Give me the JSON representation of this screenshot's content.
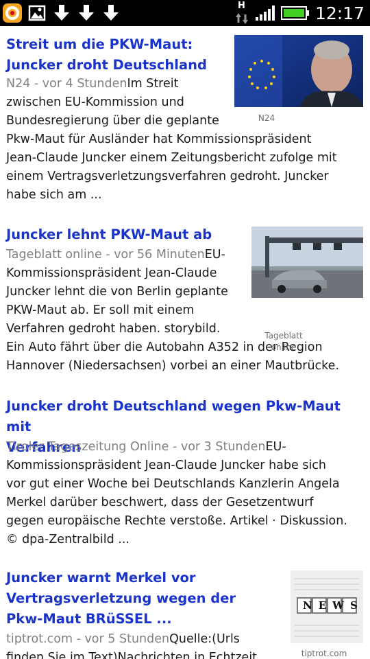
{
  "status_bar": {
    "time": "12:17",
    "network_type": "H",
    "icons": [
      "notification-app-icon",
      "image-icon",
      "download-icon",
      "download-icon",
      "download-icon",
      "data-arrows-icon",
      "signal-icon",
      "battery-icon"
    ]
  },
  "articles": [
    {
      "headline_lines": [
        "Streit um die PKW-Maut:",
        "Juncker droht Deutschland"
      ],
      "source": "N24 - vor 4 Stunden",
      "body_lines": [
        "Im Streit",
        "zwischen EU-Kommission und",
        "Bundesregierung über die geplante",
        "Pkw-Maut für Ausländer hat Kommissionspräsident",
        "Jean-Claude Juncker einem Zeitungsbericht zufolge mit",
        "einem Vertragsverletzungsverfahren gedroht. Juncker",
        "habe sich am ..."
      ],
      "thumb_caption": "N24"
    },
    {
      "headline_lines": [
        "Juncker lehnt PKW-Maut ab"
      ],
      "source": "Tageblatt online - vor 56 Minuten",
      "body_lines": [
        "EU-",
        "Kommissionspräsident Jean-Claude",
        "Juncker lehnt die von Berlin geplante",
        "PKW-Maut ab. Er soll mit einem",
        "Verfahren gedroht haben. storybild.",
        "Ein Auto fährt über die Autobahn A352 in der Region",
        "Hannover (Niedersachsen) vorbei an einer Mautbrücke."
      ],
      "thumb_caption_lines": [
        "Tageblatt",
        "online"
      ]
    },
    {
      "headline_lines": [
        "Juncker droht Deutschland wegen Pkw-Maut mit",
        "Verfahren"
      ],
      "source": "Tiroler Tageszeitung Online - vor 3 Stunden",
      "body_lines": [
        "EU-",
        "Kommissionspräsident Jean-Claude Juncker habe sich",
        "vor gut einer Woche bei Deutschlands Kanzlerin Angela",
        "Merkel darüber beschwert, dass der Gesetzentwurf",
        "gegen europäische Rechte verstoße. Artikel · Diskussion.",
        "© dpa-Zentralbild ..."
      ]
    },
    {
      "headline_lines": [
        "Juncker warnt Merkel vor",
        "Vertragsverletzung wegen der",
        "Pkw-Maut BRüSSEL ..."
      ],
      "source": "tiptrot.com - vor 5 Stunden",
      "body_lines": [
        "Quelle:(Urls",
        "finden Sie im Text)Nachrichten in Echtzeit"
      ],
      "thumb_caption": "tiptrot.com",
      "thumb_text": "NEWS"
    }
  ]
}
